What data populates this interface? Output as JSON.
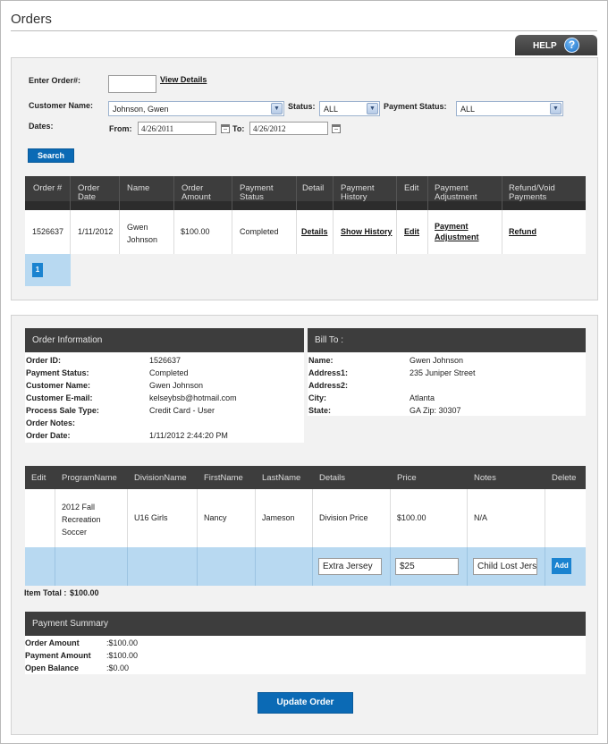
{
  "page": {
    "title": "Orders"
  },
  "help": {
    "label": "HELP",
    "icon": "question-icon",
    "glyph": "?"
  },
  "search": {
    "order_label": "Enter Order#:",
    "order_value": "",
    "view_details": "View Details",
    "customer_label": "Customer Name:",
    "customer_value": "Johnson, Gwen",
    "status_label": "Status:",
    "status_value": "ALL",
    "payment_status_label": "Payment Status:",
    "payment_status_value": "ALL",
    "dates_label": "Dates:",
    "from_label": "From:",
    "from_value": "4/26/2011",
    "to_label": "To:",
    "to_value": "4/26/2012",
    "search_button": "Search"
  },
  "orders_table": {
    "headers": [
      "Order #",
      "Order Date",
      "Name",
      "Order Amount",
      "Payment Status",
      "Detail",
      "Payment History",
      "Edit",
      "Payment Adjustment",
      "Refund/Void Payments"
    ],
    "row": {
      "order_no": "1526637",
      "date": "1/11/2012",
      "name": "Gwen Johnson",
      "amount": "$100.00",
      "status": "Completed",
      "detail": "Details",
      "history": "Show History",
      "edit": "Edit",
      "adjustment": "Payment Adjustment",
      "refund": "Refund"
    },
    "page": "1"
  },
  "order_info": {
    "title": "Order Information",
    "fields": [
      {
        "label": "Order ID:",
        "value": "1526637"
      },
      {
        "label": "Payment Status:",
        "value": "Completed"
      },
      {
        "label": "Customer Name:",
        "value": "Gwen Johnson"
      },
      {
        "label": "Customer E-mail:",
        "value": "kelseybsb@hotmail.com"
      },
      {
        "label": "Process Sale Type:",
        "value": "Credit Card - User"
      },
      {
        "label": "Order Notes:",
        "value": ""
      },
      {
        "label": "Order Date:",
        "value": "1/11/2012 2:44:20 PM"
      }
    ]
  },
  "bill_to": {
    "title": "Bill To :",
    "fields": [
      {
        "label": "Name:",
        "value": "Gwen Johnson"
      },
      {
        "label": "Address1:",
        "value": "235 Juniper Street"
      },
      {
        "label": "Address2:",
        "value": ""
      },
      {
        "label": "City:",
        "value": "Atlanta"
      },
      {
        "label": "State:",
        "value": "GA  Zip:  30307"
      }
    ]
  },
  "items_table": {
    "headers": [
      "Edit",
      "ProgramName",
      "DivisionName",
      "FirstName",
      "LastName",
      "Details",
      "Price",
      "Notes",
      "Delete"
    ],
    "row": {
      "program": "2012 Fall Recreation Soccer",
      "division": "U16 Girls",
      "first": "Nancy",
      "last": "Jameson",
      "details": "Division Price",
      "price": "$100.00",
      "notes": "N/A"
    },
    "add_row": {
      "details": "Extra Jersey",
      "price": "$25",
      "notes": "Child Lost Jersey",
      "add_label": "Add"
    },
    "item_total_label": "Item Total :",
    "item_total_value": "$100.00"
  },
  "payment_summary": {
    "title": "Payment Summary",
    "rows": [
      {
        "label": "Order Amount",
        "value": ":$100.00"
      },
      {
        "label": "Payment Amount",
        "value": ":$100.00"
      },
      {
        "label": "Open Balance",
        "value": ":$0.00"
      }
    ]
  },
  "update_button": "Update Order"
}
